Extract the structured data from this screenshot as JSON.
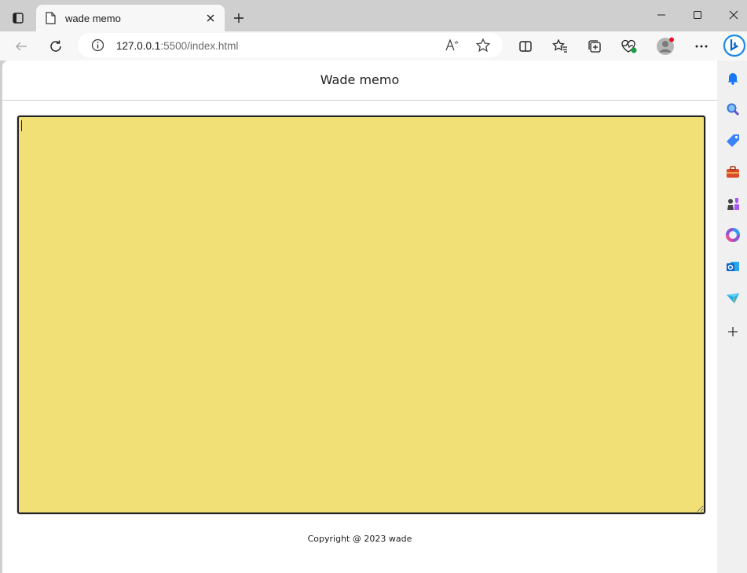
{
  "browser": {
    "tab": {
      "title": "wade memo"
    },
    "address": {
      "host": "127.0.0.1",
      "rest": ":5500/index.html"
    }
  },
  "page": {
    "title": "Wade memo",
    "memo": {
      "value": "",
      "placeholder": ""
    },
    "footer": "Copyright @ 2023 wade"
  },
  "colors": {
    "memo_background": "#f0e076",
    "chrome_background": "#cfcfcf",
    "toolbar_background": "#f7f7f7"
  },
  "icons": {
    "tab_actions": "tab-actions-icon",
    "tab_doc": "document-icon",
    "tab_close": "close-icon",
    "new_tab": "plus-icon",
    "window": [
      "minimize-icon",
      "maximize-icon",
      "close-icon"
    ],
    "nav": [
      "back-icon",
      "refresh-icon",
      "info-icon"
    ],
    "toolbar": [
      "read-aloud-icon",
      "favorite-icon",
      "split-screen-icon",
      "favorites-icon",
      "collections-icon",
      "performance-icon",
      "profile-icon",
      "more-icon",
      "bing-icon"
    ],
    "sidebar": [
      "bell-icon",
      "search-icon",
      "shopping-icon",
      "tools-icon",
      "games-icon",
      "microsoft365-icon",
      "outlook-icon",
      "send-icon",
      "add-icon"
    ]
  }
}
